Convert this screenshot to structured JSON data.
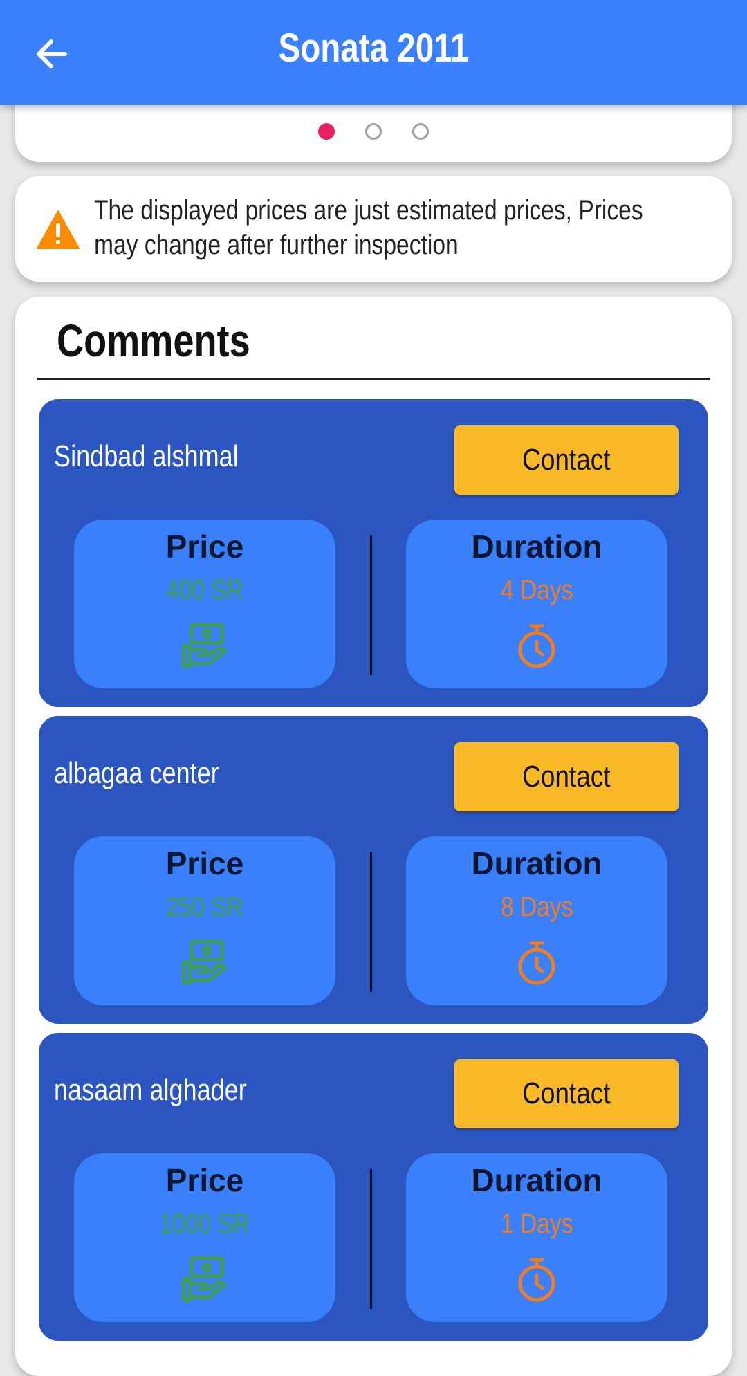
{
  "appbar": {
    "title": "Sonata 2011",
    "back_icon": "arrow-left-icon",
    "color": "#3a7ffb"
  },
  "carousel": {
    "page_count": 3,
    "active_index": 0,
    "active_color": "#e91e63"
  },
  "notice": {
    "icon": "warning-icon",
    "text": "The displayed prices are just estimated prices, Prices may change after further inspection"
  },
  "comments": {
    "title": "Comments",
    "offers": [
      {
        "name": "Sindbad alshmal",
        "contact_label": "Contact",
        "price_label": "Price",
        "price_value": "400 SR",
        "duration_label": "Duration",
        "duration_value": "4 Days"
      },
      {
        "name": "albagaa center",
        "contact_label": "Contact",
        "price_label": "Price",
        "price_value": "250 SR",
        "duration_label": "Duration",
        "duration_value": "8 Days"
      },
      {
        "name": "nasaam alghader",
        "contact_label": "Contact",
        "price_label": "Price",
        "price_value": "1000 SR",
        "duration_label": "Duration",
        "duration_value": "1 Days"
      }
    ]
  },
  "colors": {
    "offer_card": "#2b56c2",
    "stat_box": "#3a7ffb",
    "contact_button": "#f9b926",
    "price_value": "#43a047",
    "duration_value": "#f07d22",
    "warning": "#fb8c00"
  }
}
